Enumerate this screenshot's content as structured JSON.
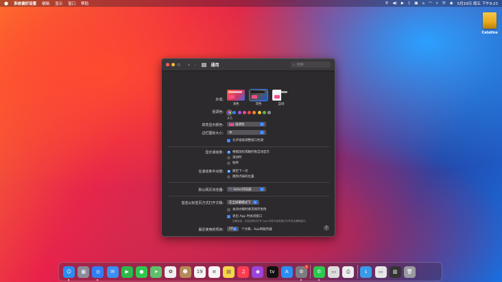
{
  "menubar": {
    "app_name": "系统偏好设置",
    "menus": [
      "编辑",
      "显示",
      "窗口",
      "帮助"
    ],
    "clock": "5月19日 周五 下午9:23"
  },
  "desktop": {
    "drive_label": "Catalina"
  },
  "window": {
    "title": "通用",
    "search_placeholder": "搜索",
    "appearance": {
      "label": "外观:",
      "options": [
        {
          "name": "浅色",
          "selected": false
        },
        {
          "name": "深色",
          "selected": true
        },
        {
          "name": "自动",
          "selected": false
        }
      ]
    },
    "accent": {
      "label": "强调色:",
      "note": "多色",
      "colors": [
        "#c4c4c4",
        "#2f7ef6",
        "#9b59d6",
        "#e84c94",
        "#ec4d4a",
        "#f08a24",
        "#f5c02c",
        "#62b845",
        "#8e8b90"
      ],
      "selected_index": 0
    },
    "highlight": {
      "label": "高亮显示颜色:",
      "value": "强调色"
    },
    "sidebar_icon": {
      "label": "边栏图标大小:",
      "value": "中"
    },
    "wallpaper_tint": {
      "label": "允许墙纸调整窗口色调",
      "checked": true
    },
    "show_scrollbars": {
      "label": "显示滚动条:",
      "options": [
        {
          "name": "根据鼠标或触控板自动显示",
          "selected": true
        },
        {
          "name": "滚动时",
          "selected": false
        },
        {
          "name": "始终",
          "selected": false
        }
      ]
    },
    "click_scrollbar": {
      "label": "在滚动条中点按:",
      "options": [
        {
          "name": "跳至下一页",
          "selected": true
        },
        {
          "name": "跳到点按的位置",
          "selected": false
        }
      ]
    },
    "default_browser": {
      "label": "默认网页浏览器:",
      "value": "Safari浏览器"
    },
    "prefer_tabs": {
      "label": "首选以标签页方式打开文稿:",
      "value": "在全屏幕模式下"
    },
    "ask_keep_changes": {
      "label": "关闭文稿时要求保存更改",
      "checked": false
    },
    "close_windows": {
      "label": "退出 App 时关闭窗口",
      "checked": true,
      "note": "如果选定，则当您再次打开 App 时将不会恢复已打开的文稿和窗口。"
    },
    "recent_items": {
      "label": "最近使用的项目:",
      "value": "10",
      "suffix": "个文稿、App和服务器"
    },
    "help": "?"
  },
  "dock": {
    "apps": [
      {
        "name": "finder-icon",
        "color": "#2b8cf0",
        "glyph": "☺",
        "running": true
      },
      {
        "name": "launchpad-icon",
        "color": "#8b8b9a",
        "glyph": "▦",
        "running": false
      },
      {
        "name": "safari-icon",
        "color": "#2f7ef6",
        "glyph": "◎",
        "running": true
      },
      {
        "name": "mail-icon",
        "color": "#3b8ff0",
        "glyph": "✉",
        "running": false
      },
      {
        "name": "facetime-icon",
        "color": "#2db84c",
        "glyph": "▶",
        "running": false
      },
      {
        "name": "messages-icon",
        "color": "#2fc84e",
        "glyph": "●",
        "running": false
      },
      {
        "name": "maps-icon",
        "color": "#5fbf6a",
        "glyph": "➤",
        "running": false
      },
      {
        "name": "photos-icon",
        "color": "#f0f0f0",
        "glyph": "✿",
        "running": false
      },
      {
        "name": "contacts-icon",
        "color": "#b58a5a",
        "glyph": "☻",
        "running": false
      },
      {
        "name": "calendar-icon",
        "color": "#f4f4f4",
        "glyph": "19",
        "running": false
      },
      {
        "name": "reminders-icon",
        "color": "#f6f6f6",
        "glyph": "≡",
        "running": false
      },
      {
        "name": "notes-icon",
        "color": "#f7d54a",
        "glyph": "▤",
        "running": false
      },
      {
        "name": "music-icon",
        "color": "#fc3c52",
        "glyph": "♫",
        "running": false
      },
      {
        "name": "podcasts-icon",
        "color": "#9a44d8",
        "glyph": "◉",
        "running": false
      },
      {
        "name": "appletv-icon",
        "color": "#111111",
        "glyph": "tv",
        "running": false
      },
      {
        "name": "appstore-icon",
        "color": "#2c8ef0",
        "glyph": "A",
        "running": false
      },
      {
        "name": "system-preferences-icon",
        "color": "#7c7c80",
        "glyph": "⚙",
        "running": true,
        "badge": "1"
      }
    ],
    "apps2": [
      {
        "name": "wechat-icon",
        "color": "#2dc84e",
        "glyph": "✆",
        "running": true
      },
      {
        "name": "screens-icon",
        "color": "#dddddd",
        "glyph": "▭",
        "running": false
      },
      {
        "name": "printer-icon",
        "color": "#eeeeee",
        "glyph": "⎙",
        "running": false
      }
    ],
    "folders": [
      {
        "name": "downloads-folder-icon",
        "color": "#3a9ae8",
        "glyph": "↓"
      },
      {
        "name": "documents-stack-icon",
        "color": "#e6e6e6",
        "glyph": "▭"
      },
      {
        "name": "screenshots-stack-icon",
        "color": "#333333",
        "glyph": "▥"
      },
      {
        "name": "trash-icon",
        "color": "#9a9aa0",
        "glyph": "🗑"
      }
    ]
  }
}
